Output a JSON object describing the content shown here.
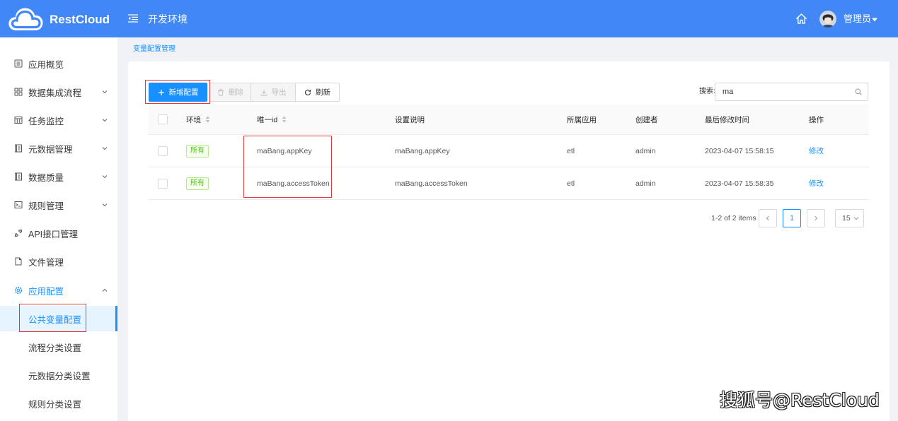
{
  "header": {
    "app_name": "RestCloud",
    "environment": "开发环境",
    "user_name": "管理员",
    "icons": {
      "logo": "cloud-logo-icon",
      "menu": "menu-fold-icon",
      "home": "home-icon",
      "avatar": "avatar",
      "caret": "caret-down-icon"
    }
  },
  "sidebar": {
    "items": [
      {
        "label": "应用概览",
        "icon": "profile-icon",
        "expandable": false
      },
      {
        "label": "数据集成流程",
        "icon": "appstore-icon",
        "expandable": true
      },
      {
        "label": "任务监控",
        "icon": "monitor-icon",
        "expandable": true
      },
      {
        "label": "元数据管理",
        "icon": "book-icon",
        "expandable": true
      },
      {
        "label": "数据质量",
        "icon": "book-icon",
        "expandable": true
      },
      {
        "label": "规则管理",
        "icon": "code-icon",
        "expandable": true
      },
      {
        "label": "API接口管理",
        "icon": "api-icon",
        "expandable": false
      },
      {
        "label": "文件管理",
        "icon": "file-icon",
        "expandable": false
      },
      {
        "label": "应用配置",
        "icon": "setting-icon",
        "expandable": true,
        "expanded": true
      }
    ],
    "sub_items": [
      {
        "label": "公共变量配置",
        "active": true
      },
      {
        "label": "流程分类设置",
        "active": false
      },
      {
        "label": "元数据分类设置",
        "active": false
      },
      {
        "label": "规则分类设置",
        "active": false
      }
    ]
  },
  "breadcrumb": "变量配置管理",
  "toolbar": {
    "add": "新增配置",
    "delete": "删除",
    "export": "导出",
    "refresh": "刷新",
    "icons": {
      "add": "plus-icon",
      "delete": "trash-icon",
      "export": "download-icon",
      "refresh": "reload-icon"
    }
  },
  "search": {
    "label": "搜索:",
    "value": "ma"
  },
  "table": {
    "columns": [
      "环境",
      "唯一id",
      "设置说明",
      "所属应用",
      "创建者",
      "最后修改时间",
      "操作"
    ],
    "rows": [
      {
        "env": "所有",
        "id": "maBang.appKey",
        "description": "maBang.appKey",
        "app": "etl",
        "creator": "admin",
        "modified": "2023-04-07 15:58:15",
        "action": "修改"
      },
      {
        "env": "所有",
        "id": "maBang.accessToken",
        "description": "maBang.accessToken",
        "app": "etl",
        "creator": "admin",
        "modified": "2023-04-07 15:58:35",
        "action": "修改"
      }
    ]
  },
  "pagination": {
    "summary": "1-2 of 2 items",
    "current_page": "1",
    "page_size": "15"
  },
  "watermark": "搜狐号@RestCloud",
  "colors": {
    "header": "#4187f5",
    "primary": "#1890ff",
    "active_bg": "#e6f4ff",
    "tag_green": "#52c41a",
    "highlight_red": "#e0383e",
    "page_bg": "#f0f2f5"
  }
}
